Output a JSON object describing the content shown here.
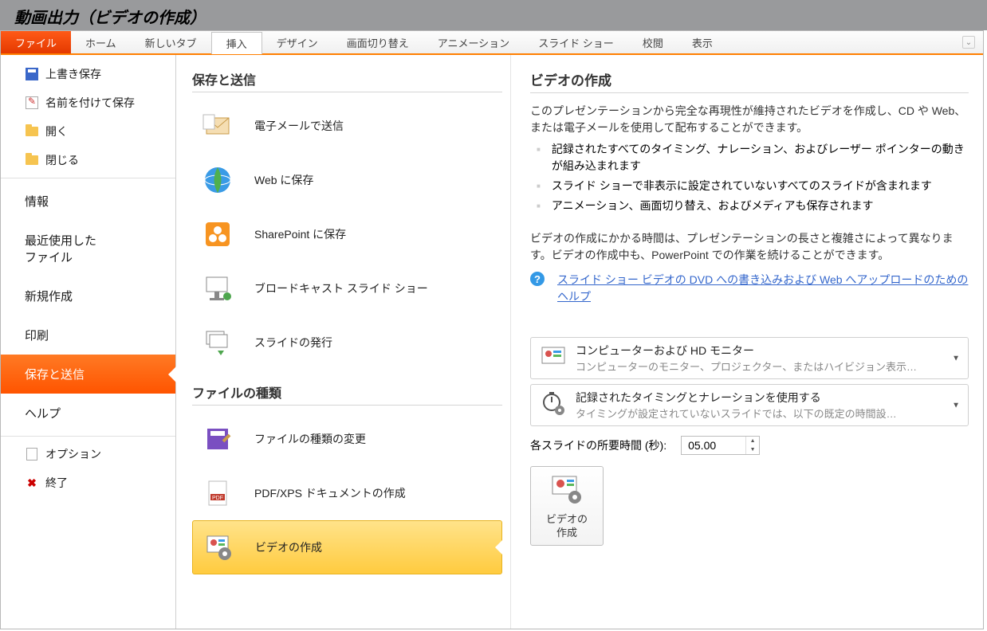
{
  "titlebar": "動画出力（ビデオの作成）",
  "ribbon": {
    "tabs": [
      "ファイル",
      "ホーム",
      "新しいタブ",
      "挿入",
      "デザイン",
      "画面切り替え",
      "アニメーション",
      "スライド ショー",
      "校閲",
      "表示"
    ],
    "active_tab": "ファイル",
    "highlighted_tab": "挿入"
  },
  "sidebar": {
    "items": [
      {
        "label": "上書き保存",
        "icon": "save-icon"
      },
      {
        "label": "名前を付けて保存",
        "icon": "save-as-icon"
      },
      {
        "label": "開く",
        "icon": "open-icon"
      },
      {
        "label": "閉じる",
        "icon": "close-folder-icon"
      },
      {
        "label": "情報",
        "large": true
      },
      {
        "label": "最近使用した\nファイル",
        "large": true
      },
      {
        "label": "新規作成",
        "large": true
      },
      {
        "label": "印刷",
        "large": true
      },
      {
        "label": "保存と送信",
        "large": true,
        "selected": true
      },
      {
        "label": "ヘルプ",
        "large": true
      },
      {
        "label": "オプション",
        "icon": "options-icon"
      },
      {
        "label": "終了",
        "icon": "exit-icon"
      }
    ]
  },
  "middle": {
    "section1_title": "保存と送信",
    "section1_items": [
      {
        "label": "電子メールで送信",
        "icon": "mail-icon"
      },
      {
        "label": "Web に保存",
        "icon": "globe-icon"
      },
      {
        "label": "SharePoint に保存",
        "icon": "sharepoint-icon"
      },
      {
        "label": "ブロードキャスト スライド ショー",
        "icon": "broadcast-icon"
      },
      {
        "label": "スライドの発行",
        "icon": "slides-publish-icon"
      }
    ],
    "section2_title": "ファイルの種類",
    "section2_items": [
      {
        "label": "ファイルの種類の変更",
        "icon": "change-type-icon"
      },
      {
        "label": "PDF/XPS ドキュメントの作成",
        "icon": "pdf-icon"
      },
      {
        "label": "ビデオの作成",
        "icon": "video-icon",
        "selected": true
      }
    ]
  },
  "right": {
    "title": "ビデオの作成",
    "desc": "このプレゼンテーションから完全な再現性が維持されたビデオを作成し、CD や Web、または電子メールを使用して配布することができます。",
    "bullets": [
      "記録されたすべてのタイミング、ナレーション、およびレーザー ポインターの動きが組み込まれます",
      "スライド ショーで非表示に設定されていないすべてのスライドが含まれます",
      "アニメーション、画面切り替え、およびメディアも保存されます"
    ],
    "desc2": "ビデオの作成にかかる時間は、プレゼンテーションの長さと複雑さによって異なります。ビデオの作成中も、PowerPoint での作業を続けることができます。",
    "help_link": "スライド ショー ビデオの DVD への書き込みおよび Web へアップロードのためのヘルプ",
    "dropdown1": {
      "title": "コンピューターおよび HD モニター",
      "sub": "コンピューターのモニター、プロジェクター、またはハイビジョン表示用…"
    },
    "dropdown2": {
      "title": "記録されたタイミングとナレーションを使用する",
      "sub": "タイミングが設定されていないスライドでは、以下の既定の時間設…"
    },
    "seconds_label": "各スライドの所要時間 (秒):",
    "seconds_value": "05.00",
    "create_button": "ビデオの\n作成"
  }
}
